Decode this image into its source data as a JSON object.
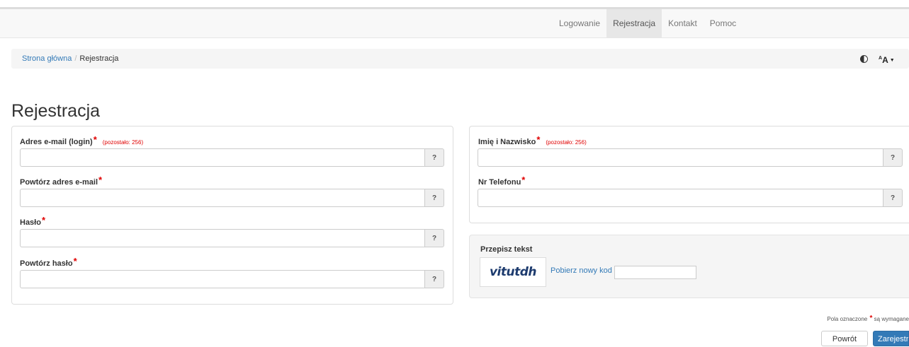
{
  "nav": {
    "items": [
      {
        "label": "Logowanie",
        "active": false
      },
      {
        "label": "Rejestracja",
        "active": true
      },
      {
        "label": "Kontakt",
        "active": false
      },
      {
        "label": "Pomoc",
        "active": false
      }
    ]
  },
  "breadcrumb": {
    "home": "Strona główna",
    "separator": "/",
    "current": "Rejestracja"
  },
  "tools": {
    "contrast_icon": "contrast-icon",
    "font_size_label": "A",
    "font_size_sup": "A"
  },
  "page": {
    "title": "Rejestracja"
  },
  "left_fields": [
    {
      "label": "Adres e-mail (login)",
      "remaining": "(pozostało: 256)",
      "value": "",
      "help": "?"
    },
    {
      "label": "Powtórz adres e-mail",
      "remaining": "",
      "value": "",
      "help": "?"
    },
    {
      "label": "Hasło",
      "remaining": "",
      "value": "",
      "help": "?"
    },
    {
      "label": "Powtórz hasło",
      "remaining": "",
      "value": "",
      "help": "?"
    }
  ],
  "right_fields": [
    {
      "label": "Imię i Nazwisko",
      "remaining": "(pozostało: 256)",
      "value": "",
      "help": "?"
    },
    {
      "label": "Nr Telefonu",
      "remaining": "",
      "value": "",
      "help": "?"
    }
  ],
  "required_marker": "*",
  "captcha": {
    "label": "Przepisz tekst",
    "image_text": "vitutdh",
    "refresh_link": "Pobierz nowy kod",
    "value": ""
  },
  "footer": {
    "required_note_before": "Pola oznaczone",
    "required_note_after": "są wymagane",
    "back_label": "Powrót",
    "submit_label": "Zarejestruj"
  },
  "colors": {
    "primary": "#337ab7",
    "required": "#e00000",
    "navbar_bg": "#f8f8f8"
  }
}
